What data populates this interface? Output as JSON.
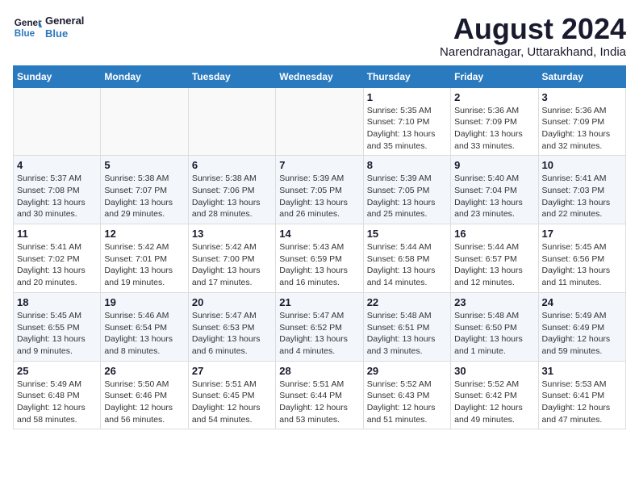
{
  "header": {
    "logo_line1": "General",
    "logo_line2": "Blue",
    "month_year": "August 2024",
    "location": "Narendranagar, Uttarakhand, India"
  },
  "days_of_week": [
    "Sunday",
    "Monday",
    "Tuesday",
    "Wednesday",
    "Thursday",
    "Friday",
    "Saturday"
  ],
  "weeks": [
    [
      {
        "day": "",
        "text": ""
      },
      {
        "day": "",
        "text": ""
      },
      {
        "day": "",
        "text": ""
      },
      {
        "day": "",
        "text": ""
      },
      {
        "day": "1",
        "text": "Sunrise: 5:35 AM\nSunset: 7:10 PM\nDaylight: 13 hours and 35 minutes."
      },
      {
        "day": "2",
        "text": "Sunrise: 5:36 AM\nSunset: 7:09 PM\nDaylight: 13 hours and 33 minutes."
      },
      {
        "day": "3",
        "text": "Sunrise: 5:36 AM\nSunset: 7:09 PM\nDaylight: 13 hours and 32 minutes."
      }
    ],
    [
      {
        "day": "4",
        "text": "Sunrise: 5:37 AM\nSunset: 7:08 PM\nDaylight: 13 hours and 30 minutes."
      },
      {
        "day": "5",
        "text": "Sunrise: 5:38 AM\nSunset: 7:07 PM\nDaylight: 13 hours and 29 minutes."
      },
      {
        "day": "6",
        "text": "Sunrise: 5:38 AM\nSunset: 7:06 PM\nDaylight: 13 hours and 28 minutes."
      },
      {
        "day": "7",
        "text": "Sunrise: 5:39 AM\nSunset: 7:05 PM\nDaylight: 13 hours and 26 minutes."
      },
      {
        "day": "8",
        "text": "Sunrise: 5:39 AM\nSunset: 7:05 PM\nDaylight: 13 hours and 25 minutes."
      },
      {
        "day": "9",
        "text": "Sunrise: 5:40 AM\nSunset: 7:04 PM\nDaylight: 13 hours and 23 minutes."
      },
      {
        "day": "10",
        "text": "Sunrise: 5:41 AM\nSunset: 7:03 PM\nDaylight: 13 hours and 22 minutes."
      }
    ],
    [
      {
        "day": "11",
        "text": "Sunrise: 5:41 AM\nSunset: 7:02 PM\nDaylight: 13 hours and 20 minutes."
      },
      {
        "day": "12",
        "text": "Sunrise: 5:42 AM\nSunset: 7:01 PM\nDaylight: 13 hours and 19 minutes."
      },
      {
        "day": "13",
        "text": "Sunrise: 5:42 AM\nSunset: 7:00 PM\nDaylight: 13 hours and 17 minutes."
      },
      {
        "day": "14",
        "text": "Sunrise: 5:43 AM\nSunset: 6:59 PM\nDaylight: 13 hours and 16 minutes."
      },
      {
        "day": "15",
        "text": "Sunrise: 5:44 AM\nSunset: 6:58 PM\nDaylight: 13 hours and 14 minutes."
      },
      {
        "day": "16",
        "text": "Sunrise: 5:44 AM\nSunset: 6:57 PM\nDaylight: 13 hours and 12 minutes."
      },
      {
        "day": "17",
        "text": "Sunrise: 5:45 AM\nSunset: 6:56 PM\nDaylight: 13 hours and 11 minutes."
      }
    ],
    [
      {
        "day": "18",
        "text": "Sunrise: 5:45 AM\nSunset: 6:55 PM\nDaylight: 13 hours and 9 minutes."
      },
      {
        "day": "19",
        "text": "Sunrise: 5:46 AM\nSunset: 6:54 PM\nDaylight: 13 hours and 8 minutes."
      },
      {
        "day": "20",
        "text": "Sunrise: 5:47 AM\nSunset: 6:53 PM\nDaylight: 13 hours and 6 minutes."
      },
      {
        "day": "21",
        "text": "Sunrise: 5:47 AM\nSunset: 6:52 PM\nDaylight: 13 hours and 4 minutes."
      },
      {
        "day": "22",
        "text": "Sunrise: 5:48 AM\nSunset: 6:51 PM\nDaylight: 13 hours and 3 minutes."
      },
      {
        "day": "23",
        "text": "Sunrise: 5:48 AM\nSunset: 6:50 PM\nDaylight: 13 hours and 1 minute."
      },
      {
        "day": "24",
        "text": "Sunrise: 5:49 AM\nSunset: 6:49 PM\nDaylight: 12 hours and 59 minutes."
      }
    ],
    [
      {
        "day": "25",
        "text": "Sunrise: 5:49 AM\nSunset: 6:48 PM\nDaylight: 12 hours and 58 minutes."
      },
      {
        "day": "26",
        "text": "Sunrise: 5:50 AM\nSunset: 6:46 PM\nDaylight: 12 hours and 56 minutes."
      },
      {
        "day": "27",
        "text": "Sunrise: 5:51 AM\nSunset: 6:45 PM\nDaylight: 12 hours and 54 minutes."
      },
      {
        "day": "28",
        "text": "Sunrise: 5:51 AM\nSunset: 6:44 PM\nDaylight: 12 hours and 53 minutes."
      },
      {
        "day": "29",
        "text": "Sunrise: 5:52 AM\nSunset: 6:43 PM\nDaylight: 12 hours and 51 minutes."
      },
      {
        "day": "30",
        "text": "Sunrise: 5:52 AM\nSunset: 6:42 PM\nDaylight: 12 hours and 49 minutes."
      },
      {
        "day": "31",
        "text": "Sunrise: 5:53 AM\nSunset: 6:41 PM\nDaylight: 12 hours and 47 minutes."
      }
    ]
  ]
}
